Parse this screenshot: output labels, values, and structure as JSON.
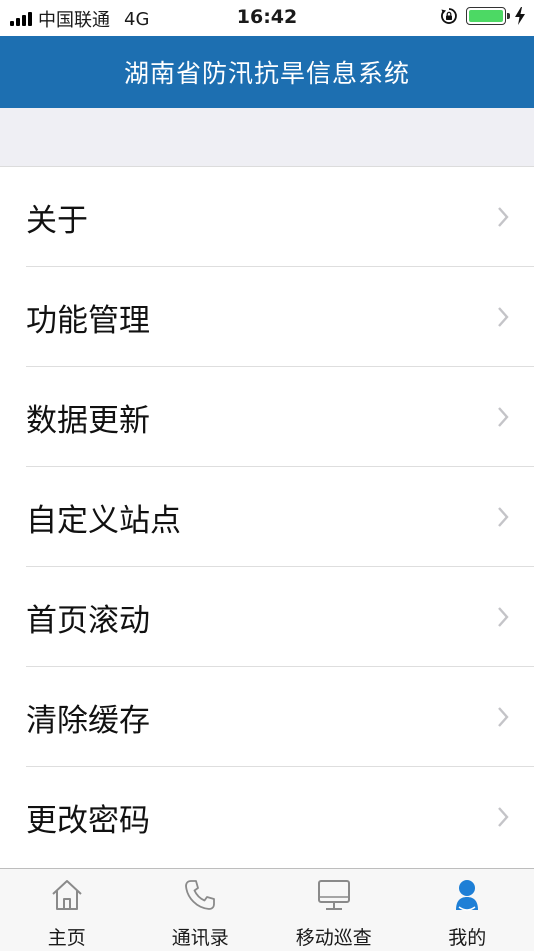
{
  "status_bar": {
    "carrier": "中国联通",
    "network": "4G",
    "time": "16:42",
    "battery_level": 1.0,
    "battery_color": "#4cd964"
  },
  "header": {
    "title": "湖南省防汛抗旱信息系统",
    "background": "#1d6fb1"
  },
  "menu": {
    "items": [
      {
        "label": "关于",
        "icon": "chevron-right-icon"
      },
      {
        "label": "功能管理",
        "icon": "chevron-right-icon"
      },
      {
        "label": "数据更新",
        "icon": "chevron-right-icon"
      },
      {
        "label": "自定义站点",
        "icon": "chevron-right-icon"
      },
      {
        "label": "首页滚动",
        "icon": "chevron-right-icon"
      },
      {
        "label": "清除缓存",
        "icon": "chevron-right-icon"
      },
      {
        "label": "更改密码",
        "icon": "chevron-right-icon"
      }
    ]
  },
  "tabs": [
    {
      "label": "主页",
      "icon": "home-icon",
      "active": false
    },
    {
      "label": "通讯录",
      "icon": "phone-icon",
      "active": false
    },
    {
      "label": "移动巡查",
      "icon": "monitor-icon",
      "active": false
    },
    {
      "label": "我的",
      "icon": "user-icon",
      "active": true
    }
  ],
  "colors": {
    "tab_active": "#1e7fd6",
    "tab_inactive": "#8a8a8a"
  }
}
